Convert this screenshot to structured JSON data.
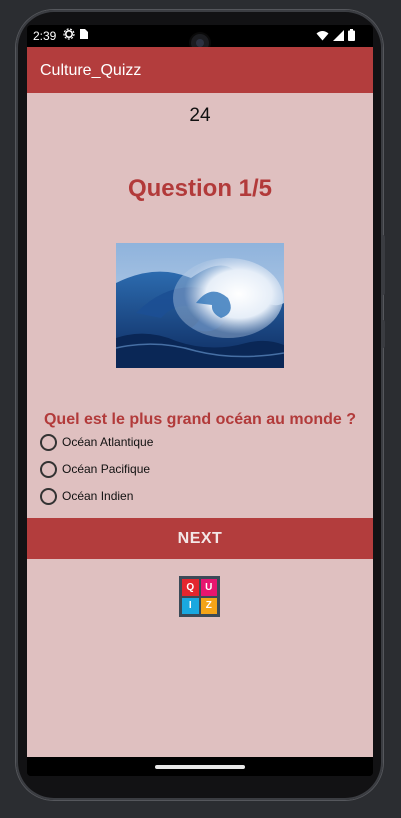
{
  "status_bar": {
    "time": "2:39",
    "icons_left": [
      "settings-gear-icon",
      "sim-card-icon"
    ],
    "icons_right": [
      "wifi-icon",
      "signal-icon",
      "battery-icon"
    ]
  },
  "app_bar": {
    "title": "Culture_Quizz"
  },
  "quiz": {
    "timer": "24",
    "question_number": "Question 1/5",
    "image_icon": "ocean-wave-image",
    "question_text": "Quel est le plus grand océan au monde ?",
    "options": [
      {
        "label": "Océan Atlantique",
        "selected": false
      },
      {
        "label": "Océan Pacifique",
        "selected": false
      },
      {
        "label": "Océan Indien",
        "selected": false
      }
    ],
    "next_label": "NEXT",
    "logo_letters": [
      "Q",
      "U",
      "I",
      "Z"
    ]
  },
  "colors": {
    "accent": "#b33d3d",
    "background": "#dfc0c0",
    "question_text": "#b23a3a",
    "logo_cells": [
      "#e3262e",
      "#e7156f",
      "#1aa8e0",
      "#f4a418"
    ]
  }
}
